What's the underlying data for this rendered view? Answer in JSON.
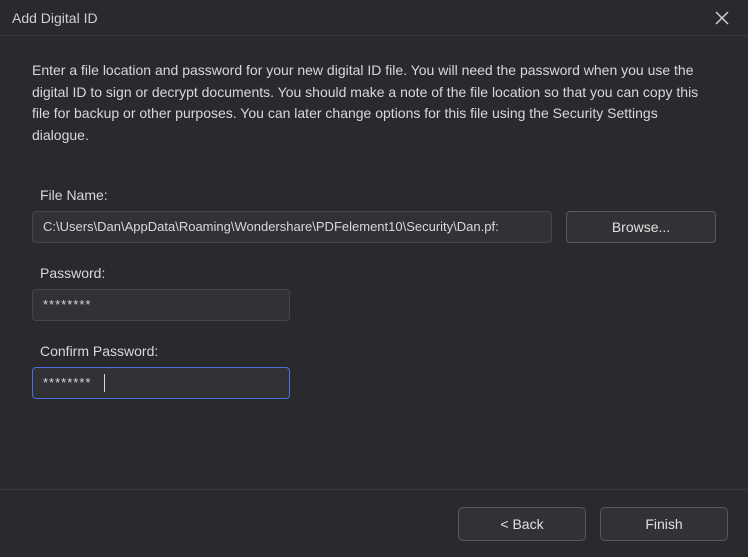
{
  "window": {
    "title": "Add Digital ID"
  },
  "description": "Enter a file location and password for your new digital ID file. You will need the password when you use the digital ID to sign or decrypt documents. You should make a note of the file location so that you can copy this file for backup or other purposes. You can later change options for this file using the Security Settings dialogue.",
  "fields": {
    "filename": {
      "label": "File Name:",
      "value": "C:\\Users\\Dan\\AppData\\Roaming\\Wondershare\\PDFelement10\\Security\\Dan.pf:",
      "browse_label": "Browse..."
    },
    "password": {
      "label": "Password:",
      "value": "********"
    },
    "confirm": {
      "label": "Confirm Password:",
      "value": "********"
    }
  },
  "footer": {
    "back_label": "< Back",
    "finish_label": "Finish"
  }
}
